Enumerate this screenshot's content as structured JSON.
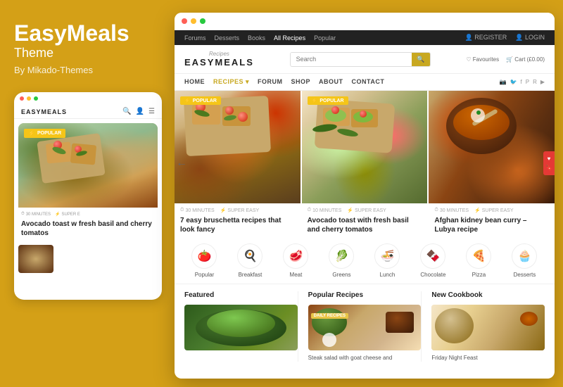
{
  "brand": {
    "name": "EasyMeals",
    "subtitle": "Theme",
    "by": "By Mikado-Themes"
  },
  "mobile": {
    "logo": "EASYMEALS",
    "card": {
      "badge": "POPULAR",
      "meta1": "30 MINUTES",
      "meta2": "SUPER E",
      "title": "Avocado toast w fresh basil and cherry tomatos"
    }
  },
  "browser": {
    "admin_nav": [
      "Forums",
      "Desserts",
      "Books",
      "All Recipes",
      "Popular"
    ],
    "admin_right": [
      "REGISTER",
      "LOGIN"
    ],
    "logo_script": "Recipes",
    "logo_main": "EASYMEALS",
    "search_placeholder": "Search",
    "header_actions": [
      "Favourites",
      "Cart (£0.00)"
    ],
    "main_nav": [
      "HOME",
      "RECIPES",
      "FORUM",
      "SHOP",
      "ABOUT",
      "CONTACT"
    ],
    "social": [
      "IG",
      "TW",
      "FB",
      "PI",
      "RSS",
      "YT"
    ]
  },
  "cards": [
    {
      "badge": "POPULAR",
      "meta1": "30 MINUTES",
      "meta2": "SUPER EASY",
      "title": "7 easy bruschetta recipes that look fancy"
    },
    {
      "badge": "POPULAR",
      "meta1": "10 MINUTES",
      "meta2": "SUPER EASY",
      "title": "Avocado toast with fresh basil and cherry tomatos"
    },
    {
      "badge": "",
      "meta1": "30 MINUTES",
      "meta2": "SUPER EASY",
      "title": "Afghan kidney bean curry – Lubya recipe"
    }
  ],
  "categories": [
    {
      "icon": "🍅",
      "label": "Popular"
    },
    {
      "icon": "🍳",
      "label": "Breakfast"
    },
    {
      "icon": "🥩",
      "label": "Meat"
    },
    {
      "icon": "🥬",
      "label": "Greens"
    },
    {
      "icon": "🍜",
      "label": "Lunch"
    },
    {
      "icon": "🍫",
      "label": "Chocolate"
    },
    {
      "icon": "🍕",
      "label": "Pizza"
    },
    {
      "icon": "🧁",
      "label": "Desserts"
    }
  ],
  "bottom": {
    "featured": {
      "title": "Featured",
      "food_desc": "Fresh green salad"
    },
    "popular": {
      "title": "Popular Recipes",
      "badge": "DAILY RECIPES",
      "recipe_title": "Steak salad with goat cheese and"
    },
    "cookbook": {
      "title": "New Cookbook",
      "book_title": "Friday Night Feast"
    }
  }
}
